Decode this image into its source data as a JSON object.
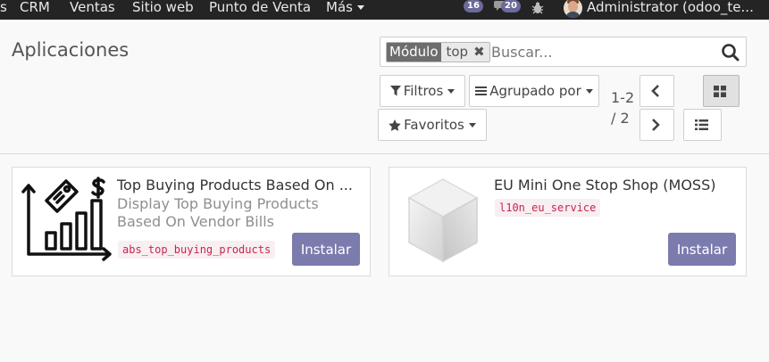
{
  "navbar": {
    "menu_items": [
      "CRM",
      "Ventas",
      "Sitio web",
      "Punto de Venta",
      "Más"
    ],
    "activity_count": "16",
    "messages_count": "20",
    "user_name": "Administrator (odoo_te..."
  },
  "control_panel": {
    "title": "Aplicaciones",
    "search": {
      "facet_label": "Módulo",
      "facet_value": "top",
      "placeholder": "Buscar..."
    },
    "filters_label": "Filtros",
    "group_by_label": "Agrupado por",
    "favorites_label": "Favoritos",
    "pager": {
      "range": "1-2",
      "total": "/ 2"
    }
  },
  "modules": [
    {
      "title": "Top Buying Products Based On ...",
      "summary": "Display Top Buying Products Based On Vendor Bills",
      "technical_name": "abs_top_buying_products",
      "button": "Instalar",
      "icon": "chart-price-tag-icon"
    },
    {
      "title": "EU Mini One Stop Shop (MOSS)",
      "summary": "",
      "technical_name": "l10n_eu_service",
      "button": "Instalar",
      "icon": "cube-placeholder-icon"
    }
  ],
  "colors": {
    "navbar_bg": "#242424",
    "primary_button": "#7c7bad",
    "technical_name": "#c7254e"
  }
}
